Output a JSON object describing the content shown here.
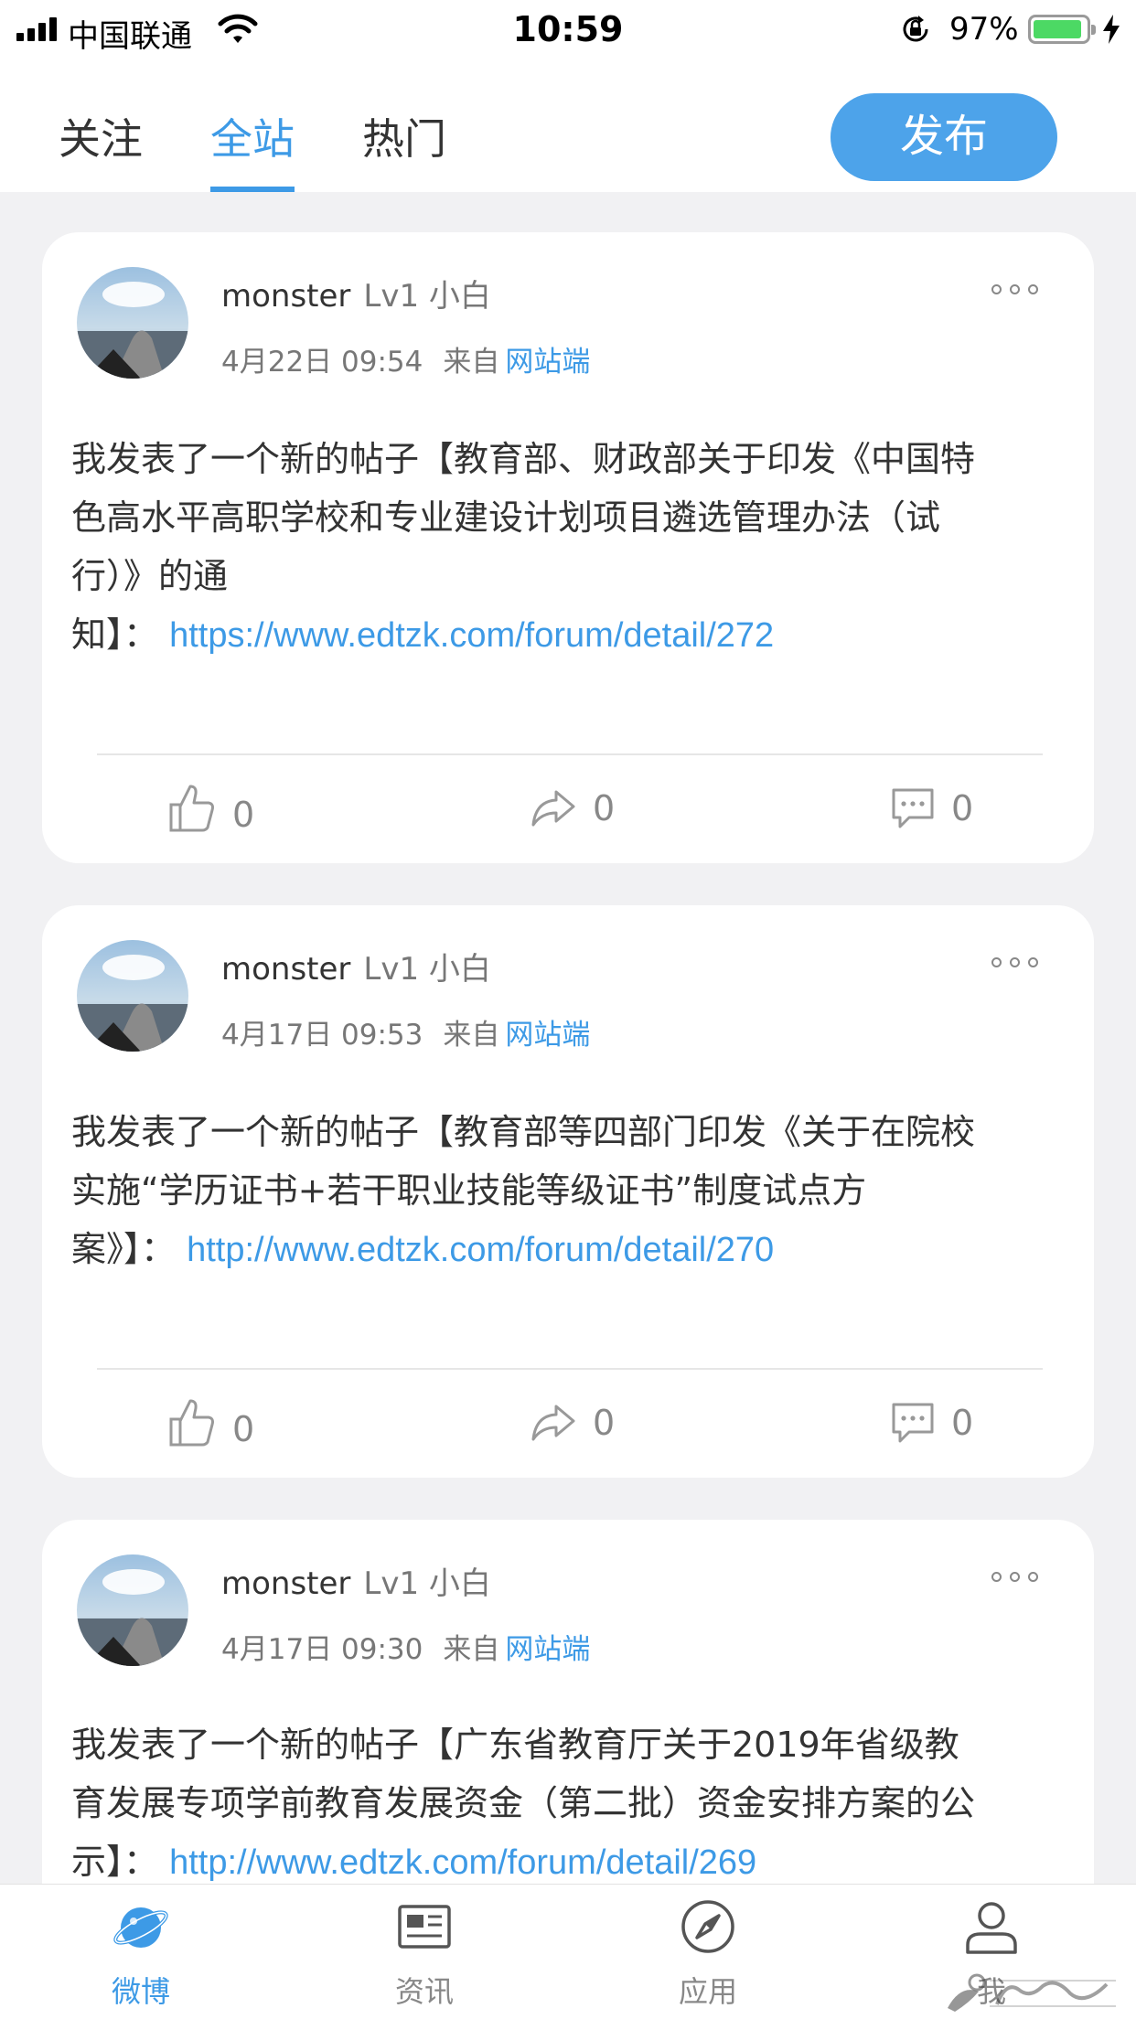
{
  "status_bar": {
    "carrier": "中国联通",
    "time": "10:59",
    "battery_percent": "97%",
    "icons": [
      "signal-icon",
      "wifi-icon",
      "orientation-lock-icon",
      "battery-icon",
      "charging-bolt-icon"
    ]
  },
  "top_nav": {
    "tabs": [
      {
        "label": "关注",
        "active": false
      },
      {
        "label": "全站",
        "active": true
      },
      {
        "label": "热门",
        "active": false
      }
    ],
    "publish_label": "发布"
  },
  "posts": [
    {
      "username": "monster",
      "level": "Lv1 小白",
      "date": "4月22日 09:54",
      "source_prefix": "来自",
      "source": "网站端",
      "content_line1": "我发表了一个新的帖子【教育部、财政部关于印发《中国特",
      "content_line2": "色高水平高职学校和专业建设计划项目遴选管理办法（试",
      "content_line3": "行）》的通",
      "content_line4_prefix": "知】：",
      "link": "https://www.edtzk.com/forum/detail/272",
      "likes": "0",
      "shares": "0",
      "comments": "0"
    },
    {
      "username": "monster",
      "level": "Lv1 小白",
      "date": "4月17日 09:53",
      "source_prefix": "来自",
      "source": "网站端",
      "content_line1": "我发表了一个新的帖子【教育部等四部门印发《关于在院校",
      "content_line2": "实施“学历证书+若干职业技能等级证书”制度试点方",
      "content_line3_prefix": "案》】：",
      "link": "http://www.edtzk.com/forum/detail/270",
      "likes": "0",
      "shares": "0",
      "comments": "0"
    },
    {
      "username": "monster",
      "level": "Lv1 小白",
      "date": "4月17日 09:30",
      "source_prefix": "来自",
      "source": "网站端",
      "content_line1": "我发表了一个新的帖子【广东省教育厅关于2019年省级教",
      "content_line2": "育发展专项学前教育发展资金（第二批）资金安排方案的公",
      "content_line3_prefix": "示】：",
      "link": "http://www.edtzk.com/forum/detail/269"
    }
  ],
  "bottom_tabs": [
    {
      "label": "微博",
      "icon": "planet-icon",
      "active": true
    },
    {
      "label": "资讯",
      "icon": "news-icon",
      "active": false
    },
    {
      "label": "应用",
      "icon": "compass-icon",
      "active": false
    },
    {
      "label": "我",
      "icon": "person-icon",
      "active": false
    }
  ],
  "accent_color": "#3d9ae6"
}
